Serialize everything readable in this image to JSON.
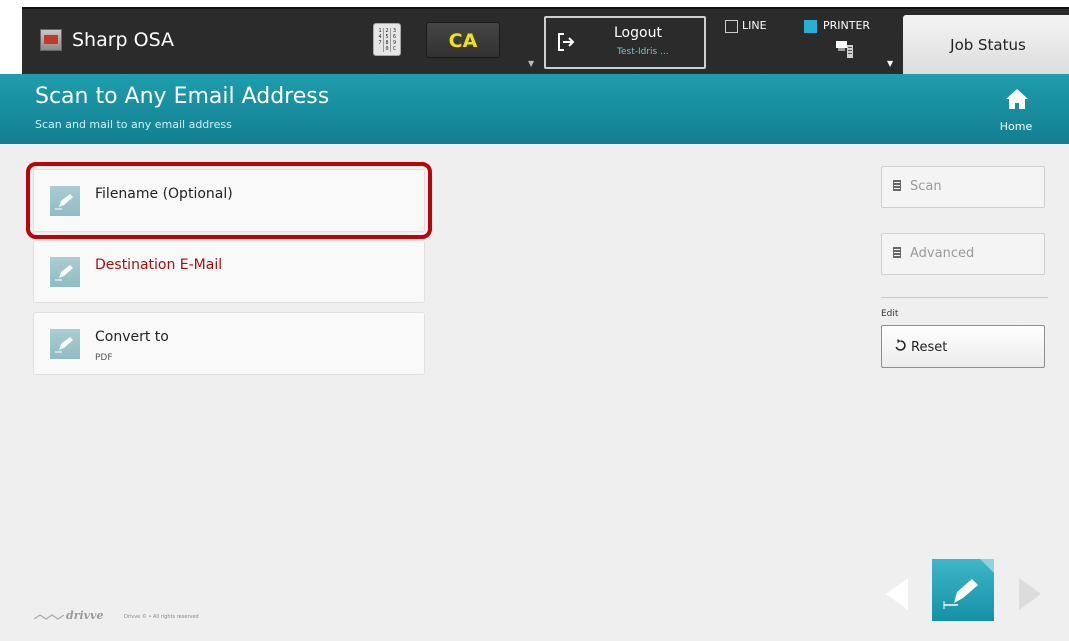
{
  "topbar": {
    "app_title": "Sharp OSA",
    "keypad_keys": [
      "1",
      "2",
      "3",
      "4",
      "5",
      "6",
      "7",
      "8",
      "9",
      "",
      "0",
      "C"
    ],
    "ca_label": "CA",
    "logout_label": "Logout",
    "logout_user": "Test-Idris ...",
    "line_label": "LINE",
    "line_checked": false,
    "printer_label": "PRINTER",
    "printer_checked": true,
    "job_status_label": "Job Status"
  },
  "header": {
    "title": "Scan to Any Email Address",
    "subtitle": "Scan and mail to any email address",
    "home_label": "Home"
  },
  "fields": [
    {
      "label": "Filename (Optional)",
      "value": "",
      "required": false,
      "selected": true
    },
    {
      "label": "Destination E-Mail",
      "value": "",
      "required": true,
      "selected": false
    },
    {
      "label": "Convert to",
      "value": "PDF",
      "required": false,
      "selected": false
    }
  ],
  "actions": {
    "scan_label": "Scan",
    "advanced_label": "Advanced",
    "edit_label": "Edit",
    "reset_label": "Reset"
  },
  "footer": {
    "brand": "drivve",
    "copyright": "Drivve © • All rights reserved"
  },
  "colors": {
    "header_teal": "#1a93a5",
    "selection_red": "#b8050a",
    "required_red": "#a01010",
    "ca_yellow": "#f2e01a",
    "printer_blue": "#27b0d4"
  }
}
